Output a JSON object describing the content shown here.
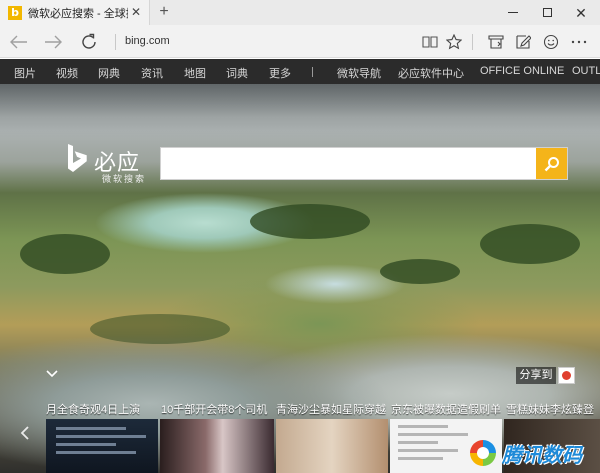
{
  "browser": {
    "tab_title": "微软必应搜索 - 全球搜...",
    "tab_favicon": "b",
    "tab_close": "✕",
    "new_tab": "+",
    "url": "bing.com",
    "icons": {
      "back": "back-arrow-icon",
      "forward": "forward-arrow-icon",
      "refresh": "refresh-icon",
      "reading_view": "book-icon",
      "favorite": "star-icon",
      "hub": "hub-icon",
      "web_note": "pen-icon",
      "feedback": "smiley-icon",
      "more": "ellipsis-icon"
    }
  },
  "bing_nav": {
    "items": [
      "图片",
      "视频",
      "网典",
      "资讯",
      "地图",
      "词典",
      "更多",
      "微软导航",
      "必应软件中心",
      "OFFICE ONLINE",
      "OUTLO"
    ]
  },
  "hero": {
    "brand": "必应",
    "brand_sub": "微软搜索",
    "search_placeholder": "",
    "share_label": "分享到",
    "accent_color": "#f4b41a"
  },
  "news": {
    "headlines": [
      "月全食奇观4日上演",
      "10千部开会带8个司机",
      "青海沙尘暴如星际穿越",
      "京东被曝数据造假刷单",
      "雪糕妹妹李炫臻登"
    ]
  },
  "watermark": {
    "text": "腾讯数码"
  }
}
